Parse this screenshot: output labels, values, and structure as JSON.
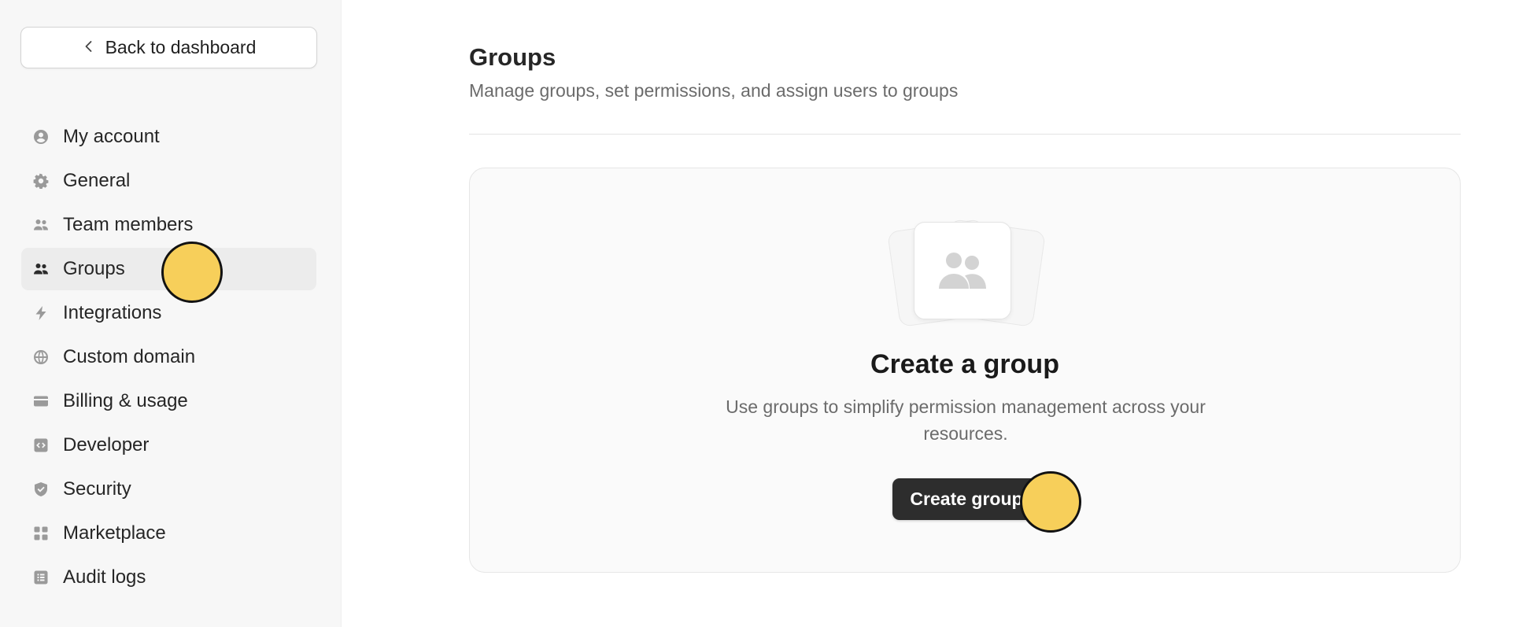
{
  "sidebar": {
    "back_label": "Back to dashboard",
    "items": [
      {
        "label": "My account",
        "icon": "user-circle-icon",
        "active": false
      },
      {
        "label": "General",
        "icon": "gear-icon",
        "active": false
      },
      {
        "label": "Team members",
        "icon": "users-icon",
        "active": false
      },
      {
        "label": "Groups",
        "icon": "group-icon",
        "active": true
      },
      {
        "label": "Integrations",
        "icon": "bolt-icon",
        "active": false
      },
      {
        "label": "Custom domain",
        "icon": "globe-icon",
        "active": false
      },
      {
        "label": "Billing & usage",
        "icon": "credit-card-icon",
        "active": false
      },
      {
        "label": "Developer",
        "icon": "code-icon",
        "active": false
      },
      {
        "label": "Security",
        "icon": "shield-icon",
        "active": false
      },
      {
        "label": "Marketplace",
        "icon": "grid-icon",
        "active": false
      },
      {
        "label": "Audit logs",
        "icon": "list-icon",
        "active": false
      }
    ]
  },
  "main": {
    "title": "Groups",
    "subtitle": "Manage groups, set permissions, and assign users to groups",
    "empty": {
      "icon": "group-icon",
      "title": "Create a group",
      "description": "Use groups to simplify permission management across your resources.",
      "button_label": "Create group"
    }
  },
  "colors": {
    "sidebar_bg": "#f7f7f7",
    "active_bg": "#ececec",
    "primary_button": "#2d2d2d",
    "cursor_marker": "#f7cf5a"
  }
}
